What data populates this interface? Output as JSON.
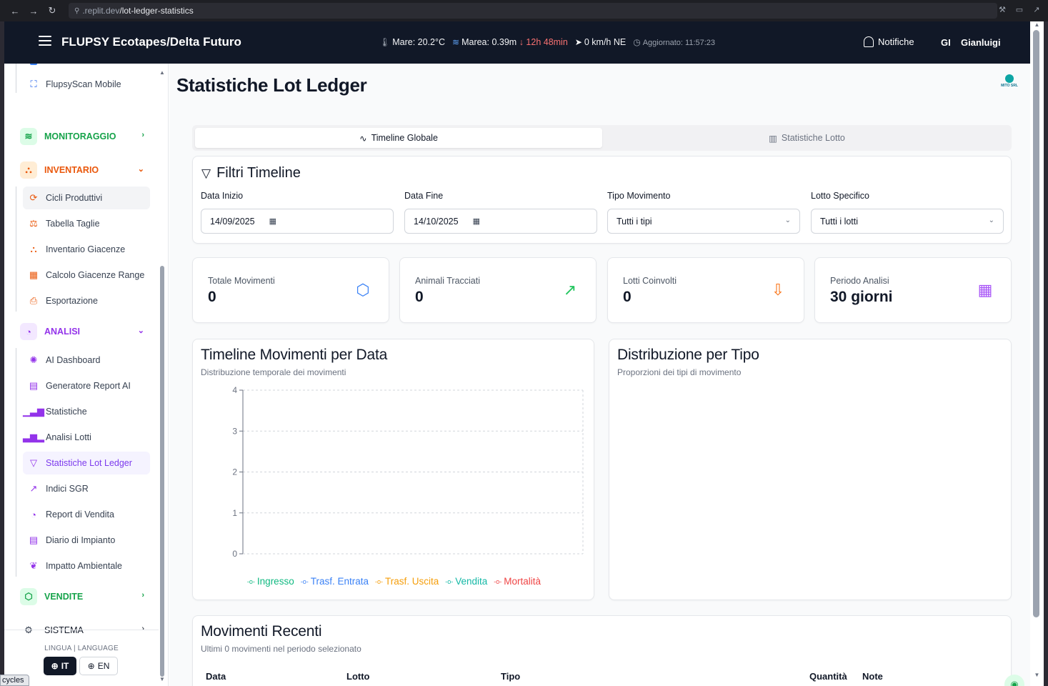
{
  "browser": {
    "url_prefix": ".replit.dev",
    "url_path": "/lot-ledger-statistics"
  },
  "header": {
    "title": "FLUPSY Ecotapes/Delta Futuro",
    "sea_temp": "Mare: 20.2°C",
    "tide": "Marea: 0.39m",
    "tide_trend": "↓ 12h 48min",
    "wind": "0 km/h NE",
    "updated": "Aggiornato: 11:57:23",
    "notifications_label": "Notifiche",
    "user_initials": "GI",
    "user_name": "Gianluigi"
  },
  "sidebar": {
    "top_items": [
      {
        "label": "FlupsyScan Mobile",
        "icon": "scan-icon"
      }
    ],
    "sections": {
      "monitoraggio": {
        "label": "MONITORAGGIO",
        "color": "#16a34a"
      },
      "inventario": {
        "label": "INVENTARIO",
        "color": "#ea580c"
      },
      "analisi": {
        "label": "ANALISI",
        "color": "#9333ea"
      },
      "vendite": {
        "label": "VENDITE",
        "color": "#16a34a"
      },
      "sistema": {
        "label": "SISTEMA",
        "color": "#111827"
      }
    },
    "inventario_items": [
      {
        "label": "Cicli Produttivi",
        "icon": "refresh-icon"
      },
      {
        "label": "Tabella Taglie",
        "icon": "scale-icon"
      },
      {
        "label": "Inventario Giacenze",
        "icon": "boxes-icon"
      },
      {
        "label": "Calcolo Giacenze Range",
        "icon": "calendar-icon"
      },
      {
        "label": "Esportazione",
        "icon": "export-icon"
      }
    ],
    "analisi_items": [
      {
        "label": "AI Dashboard",
        "icon": "brain-icon"
      },
      {
        "label": "Generatore Report AI",
        "icon": "report-icon"
      },
      {
        "label": "Statistiche",
        "icon": "bar-chart-icon"
      },
      {
        "label": "Analisi Lotti",
        "icon": "bar-chart-icon"
      },
      {
        "label": "Statistiche Lot Ledger",
        "icon": "filter-icon"
      },
      {
        "label": "Indici SGR",
        "icon": "trend-icon"
      },
      {
        "label": "Report di Vendita",
        "icon": "pie-icon"
      },
      {
        "label": "Diario di Impianto",
        "icon": "document-icon"
      },
      {
        "label": "Impatto Ambientale",
        "icon": "leaf-icon"
      }
    ],
    "language_label": "LINGUA | LANGUAGE",
    "lang_it": "IT",
    "lang_en": "EN"
  },
  "main": {
    "page_title": "Statistiche Lot Ledger",
    "logo_text": "MITO SRL",
    "tabs": [
      {
        "label": "Timeline Globale",
        "active": true
      },
      {
        "label": "Statistiche Lotto",
        "active": false
      }
    ],
    "filters": {
      "title": "Filtri Timeline",
      "start_label": "Data Inizio",
      "start_value": "14/09/2025",
      "end_label": "Data Fine",
      "end_value": "14/10/2025",
      "type_label": "Tipo Movimento",
      "type_value": "Tutti i tipi",
      "lot_label": "Lotto Specifico",
      "lot_value": "Tutti i lotti"
    },
    "stats": [
      {
        "label": "Totale Movimenti",
        "value": "0",
        "icon": "box-icon",
        "color": "#3b82f6"
      },
      {
        "label": "Animali Tracciati",
        "value": "0",
        "icon": "trending-up-icon",
        "color": "#22c55e"
      },
      {
        "label": "Lotti Coinvolti",
        "value": "0",
        "icon": "file-download-icon",
        "color": "#f97316"
      },
      {
        "label": "Periodo Analisi",
        "value": "30 giorni",
        "icon": "calendar-icon",
        "color": "#a855f7"
      }
    ],
    "timeline_card": {
      "title": "Timeline Movimenti per Data",
      "subtitle": "Distribuzione temporale dei movimenti"
    },
    "distribution_card": {
      "title": "Distribuzione per Tipo",
      "subtitle": "Proporzioni dei tipi di movimento"
    },
    "recent": {
      "title": "Movimenti Recenti",
      "subtitle": "Ultimi 0 movimenti nel periodo selezionato",
      "columns": [
        "Data",
        "Lotto",
        "Tipo",
        "Quantità",
        "Note"
      ]
    }
  },
  "tooltip_fragment": "cycles",
  "chart_data": {
    "type": "line",
    "title": "Timeline Movimenti per Data",
    "x": [],
    "ylim": [
      0,
      4
    ],
    "yticks": [
      0,
      1,
      2,
      3,
      4
    ],
    "grid": true,
    "legend_position": "bottom",
    "series": [
      {
        "name": "Ingresso",
        "color": "#10b981",
        "values": []
      },
      {
        "name": "Trasf. Entrata",
        "color": "#3b82f6",
        "values": []
      },
      {
        "name": "Trasf. Uscita",
        "color": "#f59e0b",
        "values": []
      },
      {
        "name": "Vendita",
        "color": "#14b8a6",
        "values": []
      },
      {
        "name": "Mortalità",
        "color": "#ef4444",
        "values": []
      }
    ]
  }
}
